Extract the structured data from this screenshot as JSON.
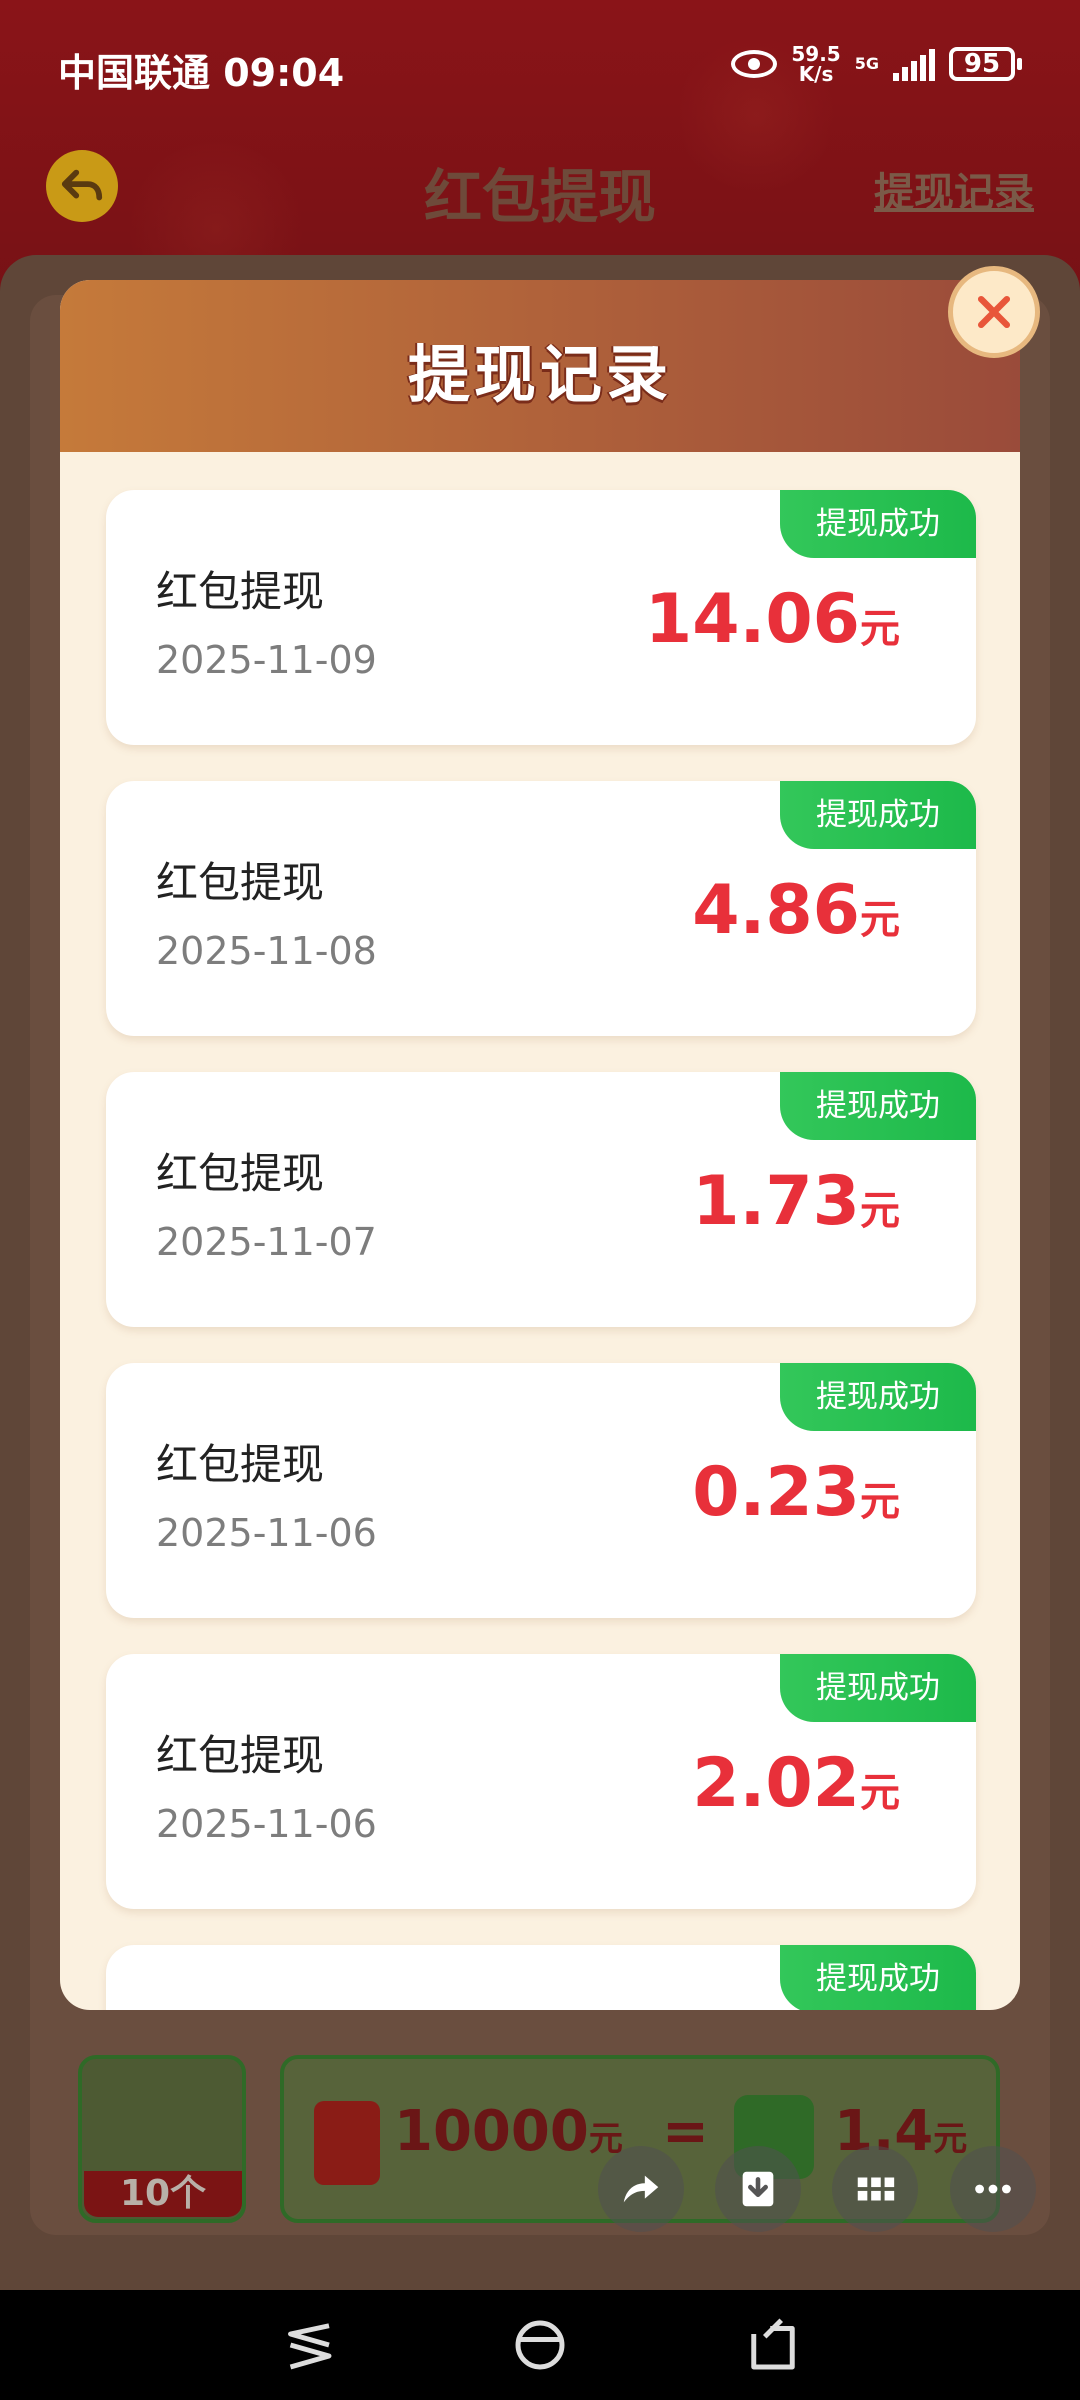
{
  "status_bar": {
    "carrier_time": "中国联通 09:04",
    "net_speed_value": "59.5",
    "net_speed_unit": "K/s",
    "network_type": "5G",
    "battery": "95"
  },
  "header": {
    "title": "红包提现",
    "history_link": "提现记录"
  },
  "modal": {
    "title": "提现记录",
    "records": [
      {
        "title": "红包提现",
        "date": "2025-11-09",
        "amount": "14.06",
        "unit": "元",
        "status": "提现成功"
      },
      {
        "title": "红包提现",
        "date": "2025-11-08",
        "amount": "4.86",
        "unit": "元",
        "status": "提现成功"
      },
      {
        "title": "红包提现",
        "date": "2025-11-07",
        "amount": "1.73",
        "unit": "元",
        "status": "提现成功"
      },
      {
        "title": "红包提现",
        "date": "2025-11-06",
        "amount": "0.23",
        "unit": "元",
        "status": "提现成功"
      },
      {
        "title": "红包提现",
        "date": "2025-11-06",
        "amount": "2.02",
        "unit": "元",
        "status": "提现成功"
      },
      {
        "status": "提现成功"
      }
    ]
  },
  "background_exchange": {
    "tile_count": "10个",
    "redpack_amount": "10000",
    "redpack_unit": "元",
    "equals": "=",
    "cash_amount": "1.4",
    "cash_unit": "元"
  },
  "colors": {
    "amount_red": "#e8303a",
    "success_green": "#1db94a",
    "modal_bg": "#fbf1e0"
  }
}
